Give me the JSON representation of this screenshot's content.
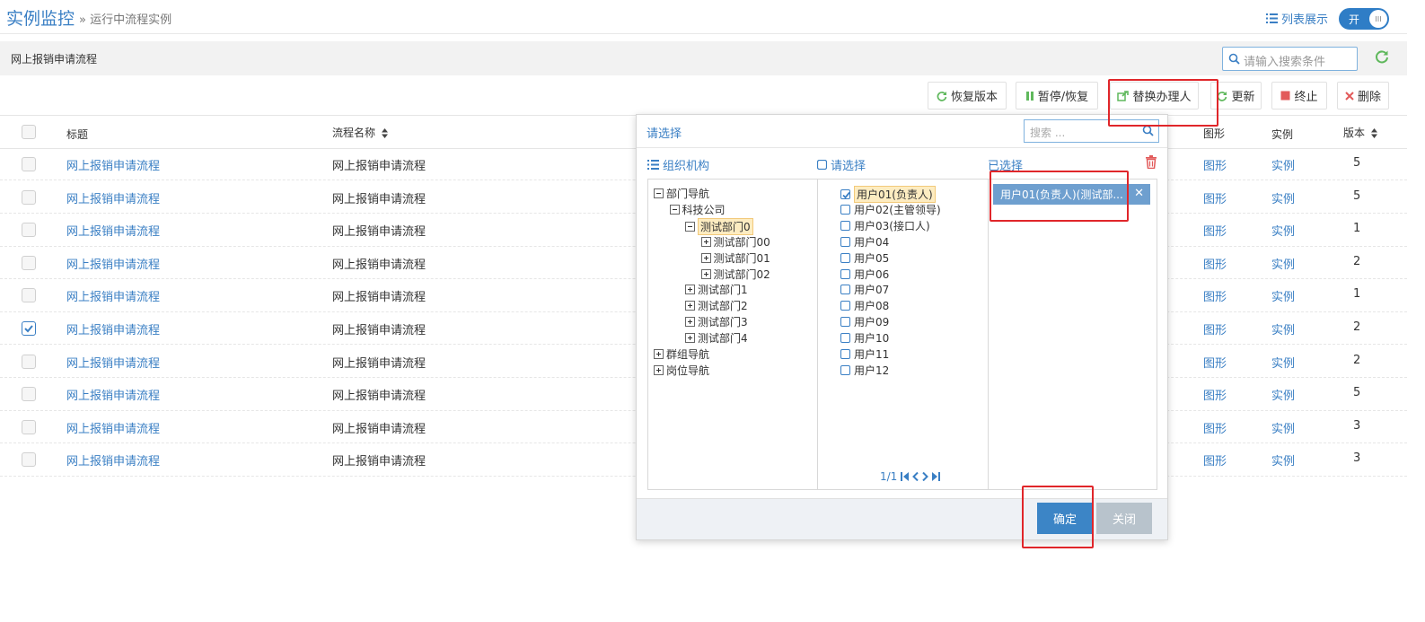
{
  "header": {
    "title": "实例监控",
    "breadcrumb": "» 运行中流程实例",
    "list_view_label": "列表展示",
    "toggle_label": "开"
  },
  "search_bar": {
    "process_name": "网上报销申请流程",
    "placeholder": "请输入搜索条件"
  },
  "toolbar": {
    "restore_version": "恢复版本",
    "pause_resume": "暂停/恢复",
    "replace_handler": "替换办理人",
    "update": "更新",
    "terminate": "终止",
    "delete": "删除"
  },
  "table": {
    "headers": {
      "title": "标题",
      "process_name": "流程名称",
      "graph": "图形",
      "instance": "实例",
      "version": "版本"
    },
    "rows": [
      {
        "title": "网上报销申请流程",
        "process": "网上报销申请流程",
        "graph": "图形",
        "instance": "实例",
        "version": "5",
        "checked": false
      },
      {
        "title": "网上报销申请流程",
        "process": "网上报销申请流程",
        "graph": "图形",
        "instance": "实例",
        "version": "5",
        "checked": false
      },
      {
        "title": "网上报销申请流程",
        "process": "网上报销申请流程",
        "graph": "图形",
        "instance": "实例",
        "version": "1",
        "checked": false
      },
      {
        "title": "网上报销申请流程",
        "process": "网上报销申请流程",
        "graph": "图形",
        "instance": "实例",
        "version": "2",
        "checked": false
      },
      {
        "title": "网上报销申请流程",
        "process": "网上报销申请流程",
        "graph": "图形",
        "instance": "实例",
        "version": "1",
        "checked": false
      },
      {
        "title": "网上报销申请流程",
        "process": "网上报销申请流程",
        "graph": "图形",
        "instance": "实例",
        "version": "2",
        "checked": true
      },
      {
        "title": "网上报销申请流程",
        "process": "网上报销申请流程",
        "graph": "图形",
        "instance": "实例",
        "version": "2",
        "checked": false
      },
      {
        "title": "网上报销申请流程",
        "process": "网上报销申请流程",
        "graph": "图形",
        "instance": "实例",
        "version": "5",
        "checked": false
      },
      {
        "title": "网上报销申请流程",
        "process": "网上报销申请流程",
        "graph": "图形",
        "instance": "实例",
        "version": "3",
        "checked": false
      },
      {
        "title": "网上报销申请流程",
        "process": "网上报销申请流程",
        "graph": "图形",
        "instance": "实例",
        "version": "3",
        "checked": false
      }
    ]
  },
  "modal": {
    "title": "请选择",
    "search_placeholder": "搜索 ...",
    "org_header": "组织机构",
    "choose_header": "请选择",
    "selected_header": "已选择",
    "tree": [
      {
        "label": "部门导航",
        "expanded": true,
        "depth": 0,
        "selected": false
      },
      {
        "label": "科技公司",
        "expanded": true,
        "depth": 1,
        "selected": false
      },
      {
        "label": "测试部门0",
        "expanded": true,
        "depth": 2,
        "selected": true
      },
      {
        "label": "测试部门00",
        "expanded": false,
        "depth": 3,
        "selected": false
      },
      {
        "label": "测试部门01",
        "expanded": false,
        "depth": 3,
        "selected": false
      },
      {
        "label": "测试部门02",
        "expanded": false,
        "depth": 3,
        "selected": false
      },
      {
        "label": "测试部门1",
        "expanded": false,
        "depth": 2,
        "selected": false
      },
      {
        "label": "测试部门2",
        "expanded": false,
        "depth": 2,
        "selected": false
      },
      {
        "label": "测试部门3",
        "expanded": false,
        "depth": 2,
        "selected": false
      },
      {
        "label": "测试部门4",
        "expanded": false,
        "depth": 2,
        "selected": false
      },
      {
        "label": "群组导航",
        "expanded": false,
        "depth": 0,
        "selected": false
      },
      {
        "label": "岗位导航",
        "expanded": false,
        "depth": 0,
        "selected": false
      }
    ],
    "users": [
      {
        "label": "用户01(负责人)",
        "checked": true
      },
      {
        "label": "用户02(主管领导)",
        "checked": false
      },
      {
        "label": "用户03(接口人)",
        "checked": false
      },
      {
        "label": "用户04",
        "checked": false
      },
      {
        "label": "用户05",
        "checked": false
      },
      {
        "label": "用户06",
        "checked": false
      },
      {
        "label": "用户07",
        "checked": false
      },
      {
        "label": "用户08",
        "checked": false
      },
      {
        "label": "用户09",
        "checked": false
      },
      {
        "label": "用户10",
        "checked": false
      },
      {
        "label": "用户11",
        "checked": false
      },
      {
        "label": "用户12",
        "checked": false
      }
    ],
    "pager_text": "1/1",
    "selected_items": [
      "用户01(负责人)(测试部..."
    ],
    "ok_label": "确定",
    "close_label": "关闭"
  },
  "colors": {
    "accent": "#3a7fc4",
    "selected_tag": "#6e9fcf",
    "annotation_red": "#e0262a"
  }
}
